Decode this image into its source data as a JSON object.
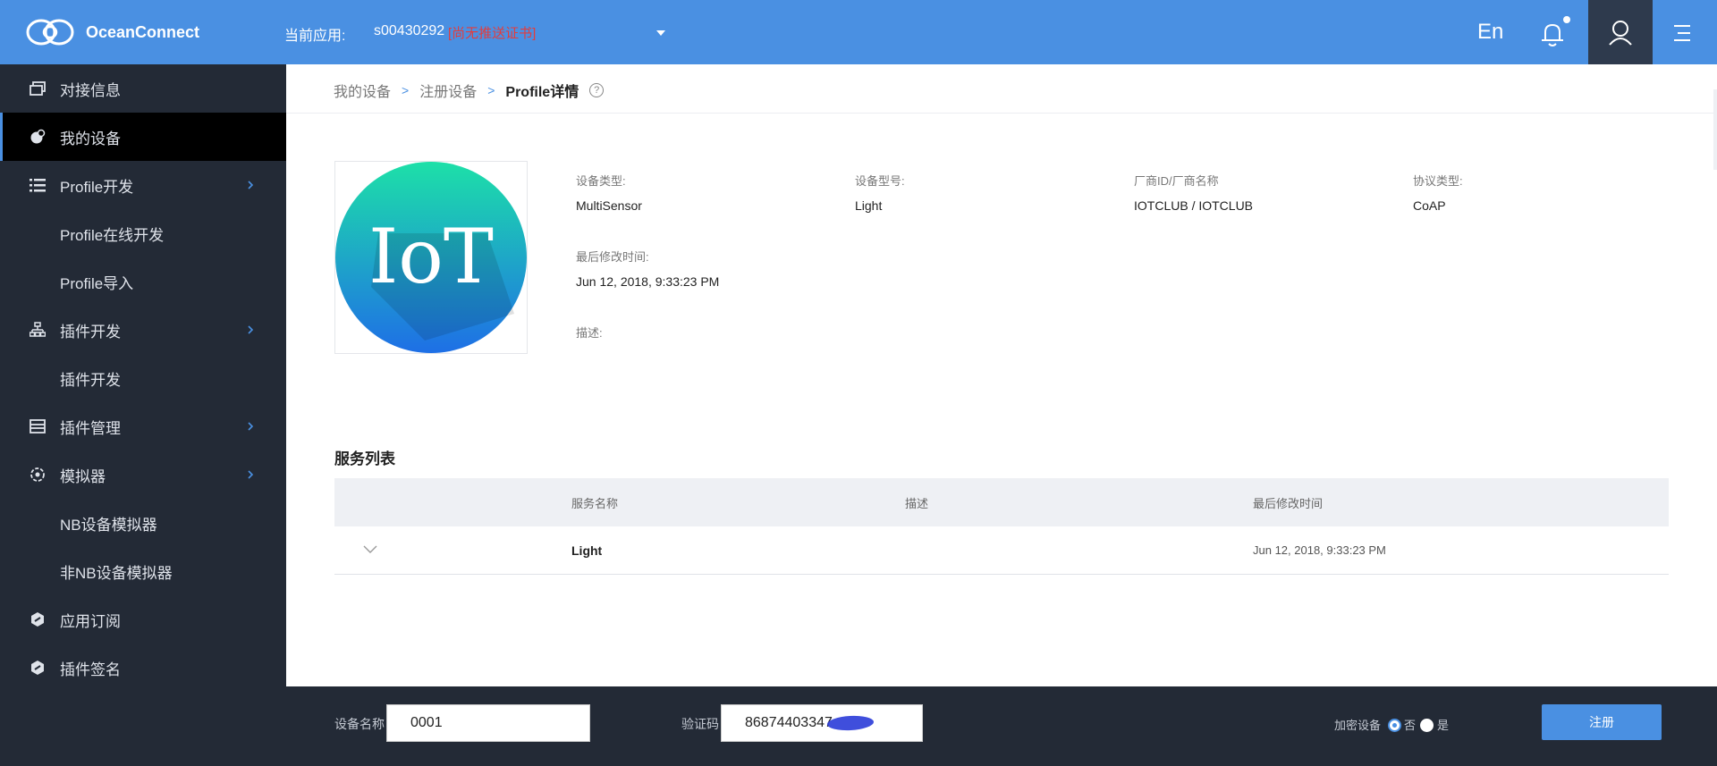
{
  "header": {
    "brand": "OceanConnect",
    "current_app_label": "当前应用:",
    "app_id": "s00430292",
    "app_warning": "[尚无推送证书]",
    "lang_toggle": "En",
    "colors": {
      "header_bg": "#4a90e2",
      "user_bg": "#2e3a4d"
    }
  },
  "sidebar": {
    "items": [
      {
        "label": "对接信息",
        "icon": "window-icon"
      },
      {
        "label": "我的设备",
        "icon": "device-icon",
        "active": true
      },
      {
        "label": "Profile开发",
        "icon": "list-icon",
        "expandable": true
      },
      {
        "label": "Profile在线开发",
        "sub": true
      },
      {
        "label": "Profile导入",
        "sub": true
      },
      {
        "label": "插件开发",
        "icon": "org-chart-icon",
        "expandable": true
      },
      {
        "label": "插件开发",
        "sub": true
      },
      {
        "label": "插件管理",
        "icon": "panel-icon",
        "expandable": true
      },
      {
        "label": "模拟器",
        "icon": "simulator-icon",
        "expandable": true
      },
      {
        "label": "NB设备模拟器",
        "sub": true
      },
      {
        "label": "非NB设备模拟器",
        "sub": true
      },
      {
        "label": "应用订阅",
        "icon": "hexagon-icon"
      },
      {
        "label": "插件签名",
        "icon": "hexagon-icon"
      }
    ]
  },
  "breadcrumb": {
    "items": [
      "我的设备",
      "注册设备"
    ],
    "current": "Profile详情",
    "help": "?"
  },
  "profile": {
    "image_text": "IoT",
    "device_type_label": "设备类型:",
    "device_type": "MultiSensor",
    "model_label": "设备型号:",
    "model": "Light",
    "vendor_label": "厂商ID/厂商名称",
    "vendor": "IOTCLUB / IOTCLUB",
    "protocol_label": "协议类型:",
    "protocol": "CoAP",
    "modified_label": "最后修改时间:",
    "modified": "Jun 12, 2018, 9:33:23 PM",
    "desc_label": "描述:"
  },
  "services": {
    "title": "服务列表",
    "columns": [
      "服务名称",
      "描述",
      "最后修改时间"
    ],
    "rows": [
      {
        "name": "Light",
        "desc": "",
        "modified": "Jun 12, 2018, 9:33:23 PM"
      }
    ]
  },
  "bottom": {
    "device_name_label": "设备名称",
    "device_name_value": "0001",
    "code_label": "验证码",
    "code_value": "86874403347",
    "encrypt_label": "加密设备",
    "encrypt_no": "否",
    "encrypt_yes": "是",
    "encrypt_selected": "否",
    "register_button": "注册"
  }
}
